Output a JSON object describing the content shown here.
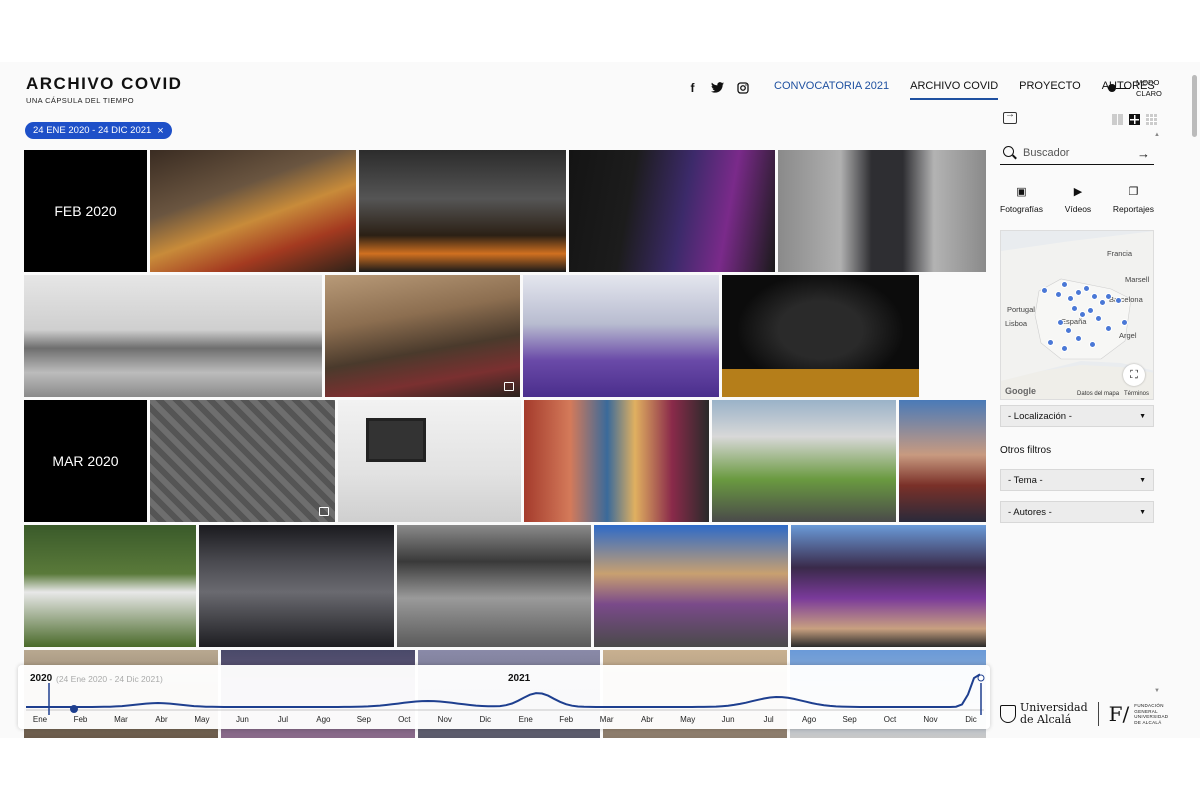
{
  "brand": {
    "title": "ARCHIVO COVID",
    "subtitle": "UNA CÁPSULA DEL TIEMPO"
  },
  "social": [
    {
      "name": "facebook-icon",
      "glyph": "f"
    },
    {
      "name": "twitter-icon",
      "glyph": "🐦"
    },
    {
      "name": "instagram-icon",
      "glyph": "◎"
    }
  ],
  "nav": {
    "convocatoria": "CONVOCATORIA 2021",
    "archivo": "ARCHIVO COVID",
    "proyecto": "PROYECTO",
    "autores": "AUTORES"
  },
  "mode": {
    "line1": "MODO",
    "line2": "CLARO"
  },
  "date_filter": {
    "label": "24 ENE 2020 - 24 DIC 2021",
    "close": "×"
  },
  "gallery": {
    "month_feb": "FEB 2020",
    "month_mar": "MAR 2020"
  },
  "timeline": {
    "year_left": "2020",
    "range": "(24 Ene 2020 - 24 Dic 2021)",
    "year_right": "2021",
    "months": [
      "Ene",
      "Feb",
      "Mar",
      "Abr",
      "May",
      "Jun",
      "Jul",
      "Ago",
      "Sep",
      "Oct",
      "Nov",
      "Dic",
      "Ene",
      "Feb",
      "Mar",
      "Abr",
      "May",
      "Jun",
      "Jul",
      "Ago",
      "Sep",
      "Oct",
      "Nov",
      "Dic"
    ],
    "accent": "#1e3f8f"
  },
  "search": {
    "placeholder": "Buscador"
  },
  "types": {
    "photos": "Fotografías",
    "videos": "Vídeos",
    "reports": "Reportajes"
  },
  "map": {
    "labels": {
      "francia": "Francia",
      "marsella": "Marsell",
      "portugal": "Portugal",
      "espana": "España",
      "lisboa": "Lisboa",
      "barcelona": "Barcelona",
      "argel": "Argel"
    },
    "google": "Google",
    "data": "Datos del mapa",
    "terms": "Términos"
  },
  "filters": {
    "location": "- Localización -",
    "others_title": "Otros filtros",
    "theme": "- Tema -",
    "authors": "- Autores -"
  },
  "logos": {
    "uah_line1": "Universidad",
    "uah_line2": "de Alcalá",
    "fund_letter": "F/",
    "fund_text": "FUNDACIÓN GENERAL UNIVERSIDAD DE ALCALÁ"
  },
  "colors": {
    "accent": "#1e50c8",
    "nav_blue": "#1e50a0"
  }
}
